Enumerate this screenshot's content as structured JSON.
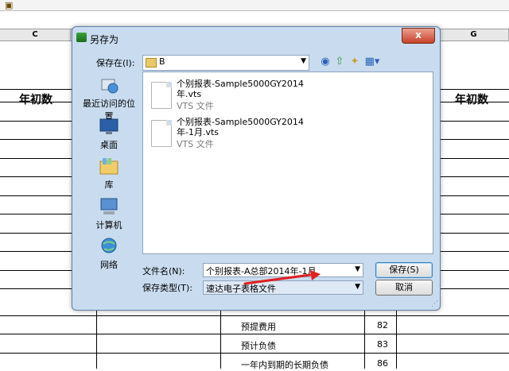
{
  "sheet": {
    "col_c": "C",
    "col_g": "G",
    "heading_left": "年初数",
    "heading_right": "年初数",
    "rows": [
      {
        "label": "预提费用",
        "line": "82"
      },
      {
        "label": "预计负债",
        "line": "83"
      },
      {
        "label": "一年内到期的长期负债",
        "line": "86"
      }
    ]
  },
  "dialog": {
    "title": "另存为",
    "close_label": "x",
    "save_in_label": "保存在(I):",
    "save_in_value": "B",
    "places": [
      {
        "label": "最近访问的位置",
        "icon": "recent-places-icon"
      },
      {
        "label": "桌面",
        "icon": "desktop-icon"
      },
      {
        "label": "库",
        "icon": "libraries-icon"
      },
      {
        "label": "计算机",
        "icon": "computer-icon"
      },
      {
        "label": "网络",
        "icon": "network-icon"
      }
    ],
    "files": [
      {
        "name_line1": "个别报表-Sample5000GY2014",
        "name_line2": "年.vts",
        "type": "VTS 文件"
      },
      {
        "name_line1": "个别报表-Sample5000GY2014",
        "name_line2": "年-1月.vts",
        "type": "VTS 文件"
      }
    ],
    "filename_label": "文件名(N):",
    "filename_value": "个别报表-A总部2014年-1月",
    "filetype_label": "保存类型(T):",
    "filetype_value": "速达电子表格文件",
    "save_button": "保存(S)",
    "cancel_button": "取消"
  },
  "colors": {
    "dialog_bg": "#c9dcef",
    "annotation_arrow": "#e02020"
  }
}
